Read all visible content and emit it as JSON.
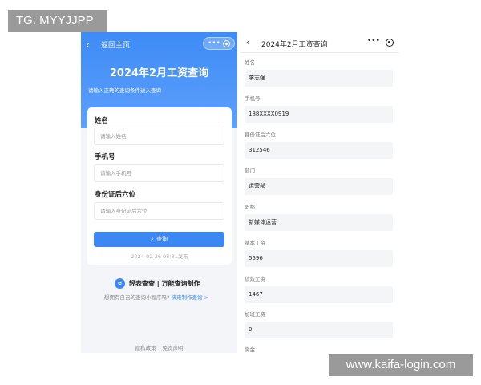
{
  "watermarks": {
    "top": "TG: MYYJJPP",
    "bottom": "www.kaifa-login.com"
  },
  "left_screen": {
    "back_icon": "‹",
    "back_label": "返回主页",
    "capsule_dots": "•••",
    "title": "2024年2月工资查询",
    "subtitle": "请输入正确的查询条件进入查询",
    "form": {
      "name_label": "姓名",
      "name_placeholder": "请输入姓名",
      "phone_label": "手机号",
      "phone_placeholder": "请输入手机号",
      "id_label": "身份证后六位",
      "id_placeholder": "请输入身份证后六位",
      "query_button": "查询",
      "search_glyph": "⌕",
      "publish_time": "2024-02-26 08:31发布"
    },
    "brand": {
      "logo_glyph": "e",
      "name": "轻表查查 | 万能查询制作",
      "prompt": "想拥有自己的查询小程序吗?",
      "link": "快来制作查询 >"
    },
    "footer": {
      "privacy": "隐私政策",
      "disclaimer": "免责声明"
    }
  },
  "right_screen": {
    "back_icon": "‹",
    "title": "2024年2月工资查询",
    "menu_dots": "•••",
    "fields": [
      {
        "label": "姓名",
        "value": "李志强"
      },
      {
        "label": "手机号",
        "value": "188XXXX0919"
      },
      {
        "label": "身份证后六位",
        "value": "312546"
      },
      {
        "label": "部门",
        "value": "运营部"
      },
      {
        "label": "职称",
        "value": "新媒体运营"
      },
      {
        "label": "基本工资",
        "value": "5596"
      },
      {
        "label": "绩效工资",
        "value": "1467"
      },
      {
        "label": "加班工资",
        "value": "0"
      },
      {
        "label": "奖金",
        "value": ""
      }
    ]
  },
  "colors": {
    "accent": "#3d87f5",
    "header_gradient_top": "#3d8bf6",
    "page_bg": "#f3f5f9",
    "field_bg": "#f4f5f7"
  }
}
